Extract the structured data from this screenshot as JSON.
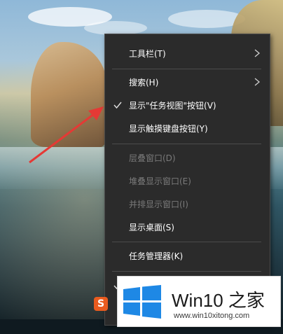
{
  "context_menu": {
    "items": [
      {
        "label": "工具栏(T)"
      },
      {
        "label": "搜索(H)"
      },
      {
        "label": "显示\"任务视图\"按钮(V)"
      },
      {
        "label": "显示触摸键盘按钮(Y)"
      },
      {
        "label": "层叠窗口(D)"
      },
      {
        "label": "堆叠显示窗口(E)"
      },
      {
        "label": "并排显示窗口(I)"
      },
      {
        "label": "显示桌面(S)"
      },
      {
        "label": "任务管理器(K)"
      }
    ]
  },
  "watermark": {
    "title": "Win10 之家",
    "url": "www.win10xitong.com"
  },
  "colors": {
    "menu_bg": "#2b2b2b",
    "arrow": "#e53935",
    "win_logo": "#1e88e5"
  },
  "icons": {
    "submenu_arrow": "chevron-right-icon",
    "checked": "checkmark-icon",
    "sogou": "sogou-icon"
  }
}
